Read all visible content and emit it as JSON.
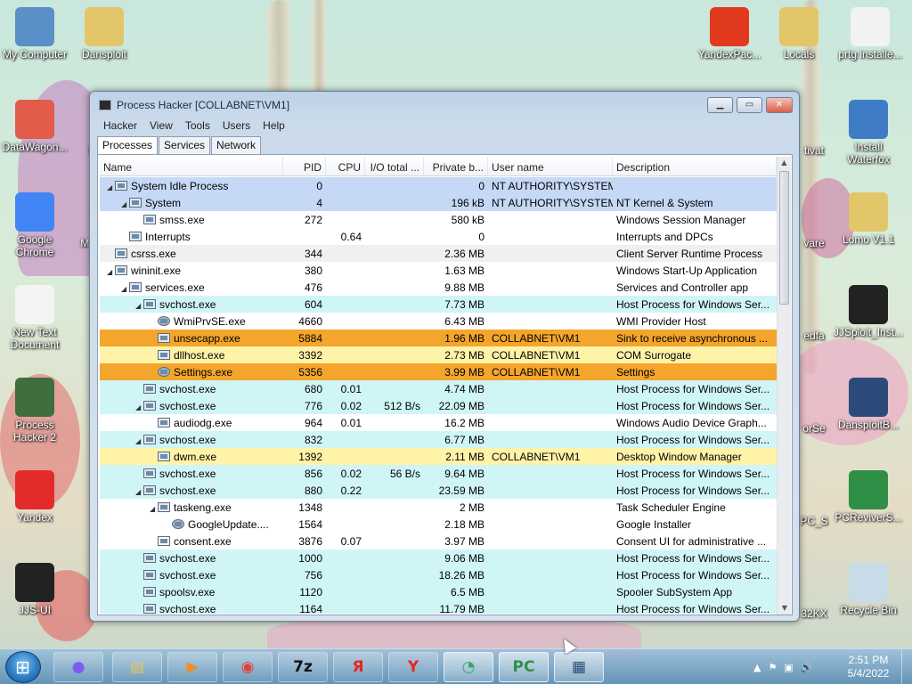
{
  "desktop": {
    "icons_left": [
      {
        "label": "My Computer",
        "icon": "computer-icon",
        "color": "#5a8fc8"
      },
      {
        "label": "Dansploit",
        "icon": "folder-icon",
        "color": "#e3c56a"
      },
      {
        "label": "DataWagon...",
        "icon": "app-icon",
        "color": "#e25b4b"
      },
      {
        "label": "Google Chrome",
        "icon": "chrome-icon",
        "color": "#4285f4"
      },
      {
        "label": "New Text Document",
        "icon": "document-icon",
        "color": "#f4f4f4"
      },
      {
        "label": "Process Hacker 2",
        "icon": "process-hacker-icon",
        "color": "#3f6f3f"
      },
      {
        "label": "Yandex",
        "icon": "yandex-browser-icon",
        "color": "#e32b2b"
      },
      {
        "label": "JJS-UI",
        "icon": "wrd-icon",
        "color": "#222222"
      }
    ],
    "icons_right": [
      {
        "label": "YandexPac...",
        "icon": "yandex-pack-icon",
        "color": "#e23a1e"
      },
      {
        "label": "Locals",
        "icon": "folder-icon",
        "color": "#e3c56a"
      },
      {
        "label": "prtg installe...",
        "icon": "prtg-icon",
        "color": "#f2f2f2"
      },
      {
        "label": "Install Waterfox",
        "icon": "installer-icon",
        "color": "#3e7dc6"
      },
      {
        "label": "Lomo V1.1",
        "icon": "folder-icon",
        "color": "#e3c56a"
      },
      {
        "label": "JJSploit_Inst...",
        "icon": "wrd-icon",
        "color": "#222222"
      },
      {
        "label": "DansploitB...",
        "icon": "wolf-icon",
        "color": "#2c4b7a"
      },
      {
        "label": "PCReviverS...",
        "icon": "pcreviver-icon",
        "color": "#2f8f46"
      },
      {
        "label": "Recycle Bin",
        "icon": "recycle-bin-icon",
        "color": "#c8dbe8"
      }
    ],
    "partial_labels": [
      "PC",
      "Mal",
      "tivat",
      "vare",
      "edfa",
      "orSe",
      "PC_S",
      "32KX"
    ]
  },
  "window": {
    "title": "Process Hacker [COLLABNET\\VM1]",
    "minimize": "▁",
    "maximize": "▭",
    "close": "✕",
    "menu": [
      "Hacker",
      "View",
      "Tools",
      "Users",
      "Help"
    ],
    "tabs": [
      "Processes",
      "Services",
      "Network"
    ],
    "active_tab": "Processes",
    "columns": [
      "Name",
      "PID",
      "CPU",
      "I/O total ...",
      "Private b...",
      "User name",
      "Description"
    ],
    "rows": [
      {
        "indent": 0,
        "expander": "◢",
        "icon": "window",
        "name": "System Idle Process",
        "pid": "0",
        "cpu": "",
        "io": "",
        "priv": "0",
        "user": "NT AUTHORITY\\SYSTEM",
        "desc": "",
        "bg": "#c5d8f5"
      },
      {
        "indent": 1,
        "expander": "◢",
        "icon": "window",
        "name": "System",
        "pid": "4",
        "cpu": "",
        "io": "",
        "priv": "196 kB",
        "user": "NT AUTHORITY\\SYSTEM",
        "desc": "NT Kernel & System",
        "bg": "#c5d8f5"
      },
      {
        "indent": 2,
        "expander": "",
        "icon": "window",
        "name": "smss.exe",
        "pid": "272",
        "cpu": "",
        "io": "",
        "priv": "580 kB",
        "user": "",
        "desc": "Windows Session Manager",
        "bg": "#ffffff"
      },
      {
        "indent": 1,
        "expander": "",
        "icon": "window",
        "name": "Interrupts",
        "pid": "",
        "cpu": "0.64",
        "io": "",
        "priv": "0",
        "user": "",
        "desc": "Interrupts and DPCs",
        "bg": "#ffffff"
      },
      {
        "indent": 0,
        "expander": "",
        "icon": "window",
        "name": "csrss.exe",
        "pid": "344",
        "cpu": "",
        "io": "",
        "priv": "2.36 MB",
        "user": "",
        "desc": "Client Server Runtime Process",
        "bg": "#f0f0f0"
      },
      {
        "indent": 0,
        "expander": "◢",
        "icon": "window",
        "name": "wininit.exe",
        "pid": "380",
        "cpu": "",
        "io": "",
        "priv": "1.63 MB",
        "user": "",
        "desc": "Windows Start-Up Application",
        "bg": "#ffffff"
      },
      {
        "indent": 1,
        "expander": "◢",
        "icon": "window",
        "name": "services.exe",
        "pid": "476",
        "cpu": "",
        "io": "",
        "priv": "9.88 MB",
        "user": "",
        "desc": "Services and Controller app",
        "bg": "#ffffff"
      },
      {
        "indent": 2,
        "expander": "◢",
        "icon": "window",
        "name": "svchost.exe",
        "pid": "604",
        "cpu": "",
        "io": "",
        "priv": "7.73 MB",
        "user": "",
        "desc": "Host Process for Windows Ser...",
        "bg": "#d0f5f7"
      },
      {
        "indent": 3,
        "expander": "",
        "icon": "gear",
        "name": "WmiPrvSE.exe",
        "pid": "4660",
        "cpu": "",
        "io": "",
        "priv": "6.43 MB",
        "user": "",
        "desc": "WMI Provider Host",
        "bg": "#ffffff"
      },
      {
        "indent": 3,
        "expander": "",
        "icon": "window",
        "name": "unsecapp.exe",
        "pid": "5884",
        "cpu": "",
        "io": "",
        "priv": "1.96 MB",
        "user": "COLLABNET\\VM1",
        "desc": "Sink to receive asynchronous ...",
        "bg": "#f4a52b"
      },
      {
        "indent": 3,
        "expander": "",
        "icon": "window",
        "name": "dllhost.exe",
        "pid": "3392",
        "cpu": "",
        "io": "",
        "priv": "2.73 MB",
        "user": "COLLABNET\\VM1",
        "desc": "COM Surrogate",
        "bg": "#fff3a8"
      },
      {
        "indent": 3,
        "expander": "",
        "icon": "gear",
        "name": "Settings.exe",
        "pid": "5356",
        "cpu": "",
        "io": "",
        "priv": "3.99 MB",
        "user": "COLLABNET\\VM1",
        "desc": "Settings",
        "bg": "#f4a52b"
      },
      {
        "indent": 2,
        "expander": "",
        "icon": "window",
        "name": "svchost.exe",
        "pid": "680",
        "cpu": "0.01",
        "io": "",
        "priv": "4.74 MB",
        "user": "",
        "desc": "Host Process for Windows Ser...",
        "bg": "#d0f5f7"
      },
      {
        "indent": 2,
        "expander": "◢",
        "icon": "window",
        "name": "svchost.exe",
        "pid": "776",
        "cpu": "0.02",
        "io": "512 B/s",
        "priv": "22.09 MB",
        "user": "",
        "desc": "Host Process for Windows Ser...",
        "bg": "#d0f5f7"
      },
      {
        "indent": 3,
        "expander": "",
        "icon": "window",
        "name": "audiodg.exe",
        "pid": "964",
        "cpu": "0.01",
        "io": "",
        "priv": "16.2 MB",
        "user": "",
        "desc": "Windows Audio Device Graph...",
        "bg": "#ffffff"
      },
      {
        "indent": 2,
        "expander": "◢",
        "icon": "window",
        "name": "svchost.exe",
        "pid": "832",
        "cpu": "",
        "io": "",
        "priv": "6.77 MB",
        "user": "",
        "desc": "Host Process for Windows Ser...",
        "bg": "#d0f5f7"
      },
      {
        "indent": 3,
        "expander": "",
        "icon": "window",
        "name": "dwm.exe",
        "pid": "1392",
        "cpu": "",
        "io": "",
        "priv": "2.11 MB",
        "user": "COLLABNET\\VM1",
        "desc": "Desktop Window Manager",
        "bg": "#fff3a8"
      },
      {
        "indent": 2,
        "expander": "",
        "icon": "window",
        "name": "svchost.exe",
        "pid": "856",
        "cpu": "0.02",
        "io": "56 B/s",
        "priv": "9.64 MB",
        "user": "",
        "desc": "Host Process for Windows Ser...",
        "bg": "#d0f5f7"
      },
      {
        "indent": 2,
        "expander": "◢",
        "icon": "window",
        "name": "svchost.exe",
        "pid": "880",
        "cpu": "0.22",
        "io": "",
        "priv": "23.59 MB",
        "user": "",
        "desc": "Host Process for Windows Ser...",
        "bg": "#d0f5f7"
      },
      {
        "indent": 3,
        "expander": "◢",
        "icon": "window",
        "name": "taskeng.exe",
        "pid": "1348",
        "cpu": "",
        "io": "",
        "priv": "2 MB",
        "user": "",
        "desc": "Task Scheduler Engine",
        "bg": "#ffffff"
      },
      {
        "indent": 4,
        "expander": "",
        "icon": "gear",
        "name": "GoogleUpdate....",
        "pid": "1564",
        "cpu": "",
        "io": "",
        "priv": "2.18 MB",
        "user": "",
        "desc": "Google Installer",
        "bg": "#ffffff"
      },
      {
        "indent": 3,
        "expander": "",
        "icon": "doc",
        "name": "consent.exe",
        "pid": "3876",
        "cpu": "0.07",
        "io": "",
        "priv": "3.97 MB",
        "user": "",
        "desc": "Consent UI for administrative ...",
        "bg": "#ffffff"
      },
      {
        "indent": 2,
        "expander": "",
        "icon": "window",
        "name": "svchost.exe",
        "pid": "1000",
        "cpu": "",
        "io": "",
        "priv": "9.06 MB",
        "user": "",
        "desc": "Host Process for Windows Ser...",
        "bg": "#d0f5f7"
      },
      {
        "indent": 2,
        "expander": "",
        "icon": "window",
        "name": "svchost.exe",
        "pid": "756",
        "cpu": "",
        "io": "",
        "priv": "18.26 MB",
        "user": "",
        "desc": "Host Process for Windows Ser...",
        "bg": "#d0f5f7"
      },
      {
        "indent": 2,
        "expander": "",
        "icon": "window",
        "name": "spoolsv.exe",
        "pid": "1120",
        "cpu": "",
        "io": "",
        "priv": "6.5 MB",
        "user": "",
        "desc": "Spooler SubSystem App",
        "bg": "#d0f5f7"
      },
      {
        "indent": 2,
        "expander": "",
        "icon": "window",
        "name": "svchost.exe",
        "pid": "1164",
        "cpu": "",
        "io": "",
        "priv": "11.79 MB",
        "user": "",
        "desc": "Host Process for Windows Ser...",
        "bg": "#d0f5f7"
      }
    ]
  },
  "taskbar": {
    "buttons": [
      {
        "name": "alice-button",
        "glyph": "●",
        "color": "#7b5cf0"
      },
      {
        "name": "file-explorer-button",
        "glyph": "▤",
        "color": "#e7c65b"
      },
      {
        "name": "media-player-button",
        "glyph": "▶",
        "color": "#f28c2a"
      },
      {
        "name": "chrome-button",
        "glyph": "◉",
        "color": "#e34133"
      },
      {
        "name": "7zip-button",
        "glyph": "7z",
        "color": "#111111"
      },
      {
        "name": "yandex-button",
        "glyph": "Я",
        "color": "#e22"
      },
      {
        "name": "yandex-browser-button",
        "glyph": "Y",
        "color": "#e22"
      },
      {
        "name": "prtg-button",
        "glyph": "◔",
        "color": "#3a6"
      },
      {
        "name": "pcreviver-button",
        "glyph": "PC",
        "color": "#2f8f46"
      },
      {
        "name": "process-hacker-button",
        "glyph": "▦",
        "color": "#2b4f7a"
      }
    ],
    "tray_glyphs": [
      "▲",
      "⚑",
      "▣",
      "🔊"
    ],
    "time": "2:51 PM",
    "date": "5/4/2022"
  }
}
